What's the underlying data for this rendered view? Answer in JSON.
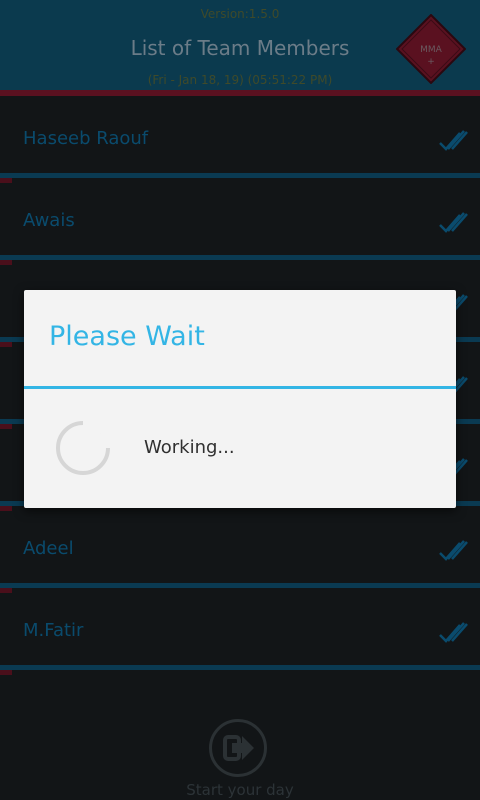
{
  "header": {
    "version": "Version:1.5.0",
    "title": "List of Team Members",
    "datetime": "(Fri - Jan 18, 19) (05:51:22 PM)",
    "logo_text": "MMA"
  },
  "members": [
    {
      "name": "Haseeb Raouf"
    },
    {
      "name": "Awais"
    },
    {
      "name": ""
    },
    {
      "name": ""
    },
    {
      "name": ""
    },
    {
      "name": "Adeel"
    },
    {
      "name": "M.Fatir"
    }
  ],
  "footer": {
    "label": "Start your day"
  },
  "dialog": {
    "title": "Please Wait",
    "message": "Working..."
  },
  "colors": {
    "accent": "#33b5e5",
    "header_bg": "#0b3a4e",
    "stripe": "#5a1120"
  },
  "icons": {
    "check": "double-check-icon",
    "footer": "exit-arrow-icon",
    "spinner": "loading-spinner-icon"
  }
}
